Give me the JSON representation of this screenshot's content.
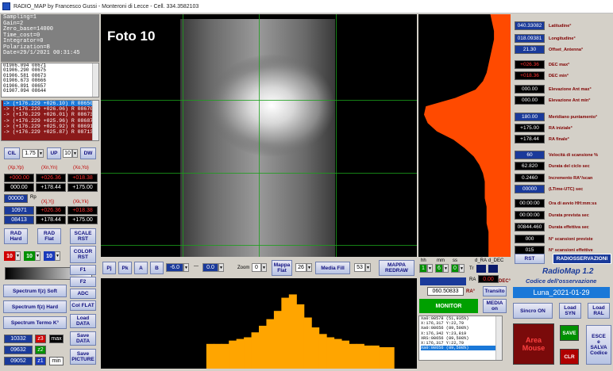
{
  "window": {
    "title": "RADIO_MAP by Francesco Gussi - Monteroni di Lecce - Cell. 334.3582103"
  },
  "status": {
    "lines": [
      "Sampling=1",
      "Gain=2",
      "Zero_base=14000",
      "Time_cost=0",
      "Integrator=0",
      "Polarization=B",
      "Date=29/1/2021 00:31:45"
    ]
  },
  "samples": [
    "01906.094 08671",
    "01906.290 08675",
    "01906.581 08673",
    "01906.673 08666",
    "01906.891 08657",
    "01907.094 08644"
  ],
  "positions": [
    "-> (+176.229 +026.10) R 08650",
    "-> (+176.229 +026.06) R 08670",
    "-> (+176.229 +026.01) R 08673",
    "-> (+176.229 +025.96) R 08687",
    "-> (+176.229 +025.92) R 08691",
    "-> (+176.229 +025.87) R 08713"
  ],
  "controls": {
    "cil": "CIL",
    "cil_value": "1.75",
    "up": "UP",
    "up_value": "10",
    "dw": "DW",
    "xpyp": "(Xp,Yp)",
    "xnyn": "(Xn,Yn)",
    "xoyo": "(Xo,Yo)",
    "xpyp_v1": "+000.00",
    "xnyn_v1": "+026.36",
    "xoyo_v1": "+018.38",
    "xpyp_v2": "000.00",
    "xnyn_v2": "+178.44",
    "xoyo_v2": "+175.00",
    "rp_value": "00000",
    "rp_label": "Rp",
    "xjyj": "(Xj,Yj)",
    "xkyk": "(Xk,Yk)",
    "rp2": "10971",
    "xjyj_v1": "+026.36",
    "xkyk_v1": "+018.38",
    "rp3": "08413",
    "xjyj_v2": "+178.44",
    "xkyk_v2": "+175.00",
    "rad_hard": "RAD\nHard",
    "rad_flat": "RAD\nFlat",
    "scale_rst": "SCALE\nRST",
    "color_rst": "COLOR\nRST",
    "col1": "10",
    "col2": "10",
    "col3": "10",
    "f1": "F1",
    "f2": "F2",
    "f3": "F3",
    "adc": "ADC",
    "col_flat": "Col FLAT",
    "spec_soft": "Spectrum f(z) Soft",
    "spec_hard": "Spectrum f(z) Hard",
    "spec_termo": "Spectrum Termo K°",
    "load_data": "Load\nDATA",
    "save_data": "Save\nDATA",
    "save_picture": "Save\nPICTURE",
    "v1": "10332",
    "z3": "z3",
    "max": "max",
    "v2": "09632",
    "z2": "z2",
    "v3": "09052",
    "z1": "z1",
    "min": "min"
  },
  "image": {
    "label": "Foto 10"
  },
  "toolbar": {
    "pj": "Pj",
    "pk": "Pk",
    "a": "A",
    "b": "B",
    "v1": "-6.0",
    "dash": "—",
    "v2": "0.0",
    "zoom": "Zoom",
    "zoom_val": "0",
    "mappa_flat": "Mappa\nFlat",
    "num1": "26",
    "media_fill": "Media Fill",
    "num2": "53",
    "mappa_redraw": "MAPPA\nREDRAW"
  },
  "clock": {
    "hh": "hh",
    "mm": "mm",
    "ss": "ss",
    "hh_v": "1",
    "mm_v": "6",
    "ss_v": "0",
    "tr": "Tr",
    "d_ra": "d_RA",
    "d_dec": "d_DEC",
    "ra_label": "RA",
    "ra_v1": "0.00",
    "ra_v2": "0.00",
    "dec_label": "DEC°",
    "ra2_label": "RA°",
    "value": "060.50833",
    "transito": "Transito",
    "monitor": "MONITOR",
    "media": "MEDIA\non"
  },
  "params": [
    {
      "value": "040.33082",
      "label": "Latitudine°"
    },
    {
      "value": "018.09381",
      "label": "Longitudine°"
    },
    {
      "value": "21.30",
      "label": "Offset_Antenna°"
    },
    {
      "value": "+026.36",
      "label": "DEC max°"
    },
    {
      "value": "+018.36",
      "label": "DEC min°"
    },
    {
      "value": "000.00",
      "label": "Elevazione Ant max°"
    },
    {
      "value": "000.00",
      "label": "Elevazione Ant min°"
    },
    {
      "value": "180.00",
      "label": "Meridiano puntamento°"
    },
    {
      "value": "+175.00",
      "label": "RA iniziale°"
    },
    {
      "value": "+178.44",
      "label": "RA finale°"
    },
    {
      "value": "60",
      "label": "Velocità di scansione %"
    },
    {
      "value": "62.820",
      "label": "Durata del ciclo sec"
    },
    {
      "value": "0.2460",
      "label": "Incremento RA°/scan"
    },
    {
      "value": "00000",
      "label": "(LTime-UTC) sec"
    },
    {
      "value": "00:00:00",
      "label": "Ora di avvio HH:mm:ss"
    },
    {
      "value": "00:00:00",
      "label": "Durata prevista sec"
    },
    {
      "value": "00844.460",
      "label": "Durata effettiva sec"
    },
    {
      "value": "000",
      "label": "N° scansioni previste"
    },
    {
      "value": "015",
      "label": "N° scansioni effettive"
    }
  ],
  "footer": {
    "rst": "RST",
    "radioosservazioni": "RADIOSSERVAZIONI",
    "app_name": "RadioMap 1.2",
    "codice": "Codice dell'osservazione",
    "observation": "Luna_2021-01-29",
    "sincro": "Sincro ON",
    "load_syn": "Load\nSYN",
    "load_ral": "Load\nRAL",
    "area_mouse": "Area\nMouse",
    "save": "SAVE",
    "clr": "CLR",
    "esce": "ESCE\ne\nSALVA\nCodice"
  },
  "messages": [
    "Xa0:08578 (51,935%)",
    "X:176,317 Y:22,79",
    "Xa0:08656 (89,508%)",
    "X:176,342 Y:23,819",
    "XRS:08656 (89,508%)",
    "X:176,317 Y:22,79",
    "Xa0:08656 (89,508%)"
  ],
  "chart_data": [
    {
      "type": "area",
      "name": "bottom-profile",
      "x": [
        0,
        1,
        2,
        3,
        4,
        5,
        6,
        7,
        8,
        9,
        10,
        11,
        12,
        13,
        14,
        15,
        16,
        17,
        18,
        19,
        20,
        21,
        22,
        23,
        24,
        25,
        26,
        27,
        28,
        29,
        30,
        31,
        32,
        33,
        34,
        35,
        36,
        37,
        38,
        39
      ],
      "values": [
        0,
        0,
        0,
        0,
        0,
        0,
        0,
        0,
        0,
        0,
        0,
        0,
        0,
        30,
        30,
        30,
        34,
        36,
        38,
        44,
        52,
        60,
        70,
        86,
        90,
        78,
        62,
        50,
        42,
        38,
        36,
        34,
        30,
        30,
        28,
        28,
        26,
        26,
        0,
        0
      ]
    },
    {
      "type": "area",
      "name": "right-profile",
      "values": [
        22,
        20,
        18,
        18,
        20,
        22,
        24,
        26,
        30,
        38,
        60,
        92,
        94,
        90,
        80,
        62,
        50,
        40,
        34,
        30,
        28,
        28,
        28,
        26,
        26,
        26,
        24,
        24,
        24,
        24
      ]
    }
  ]
}
